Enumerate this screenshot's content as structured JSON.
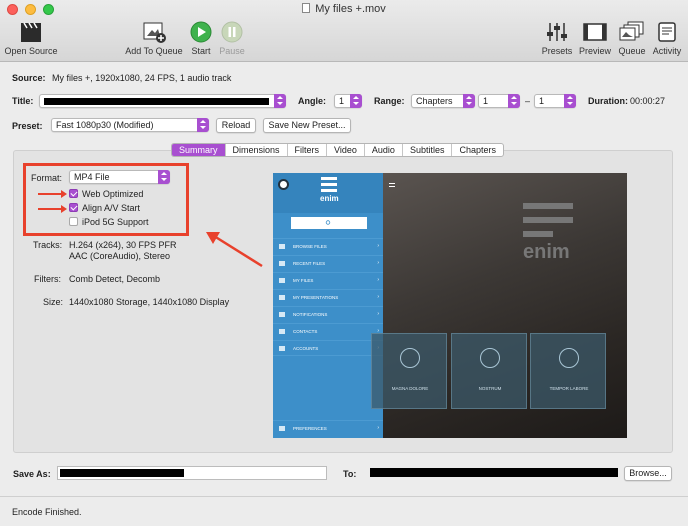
{
  "window": {
    "title": "My files +.mov"
  },
  "toolbar": {
    "open_source": "Open Source",
    "add_to_queue": "Add To Queue",
    "start": "Start",
    "pause": "Pause",
    "presets": "Presets",
    "preview": "Preview",
    "queue": "Queue",
    "activity": "Activity"
  },
  "source": {
    "label": "Source:",
    "value": "My files +, 1920x1080, 24 FPS, 1 audio track"
  },
  "title_row": {
    "label": "Title:",
    "angle_label": "Angle:",
    "angle_value": "1",
    "range_label": "Range:",
    "range_type": "Chapters",
    "range_from": "1",
    "range_sep": "–",
    "range_to": "1",
    "duration_label": "Duration:",
    "duration_value": "00:00:27"
  },
  "preset": {
    "label": "Preset:",
    "value": "Fast 1080p30 (Modified)",
    "reload": "Reload",
    "save_new": "Save New Preset..."
  },
  "tabs": [
    "Summary",
    "Dimensions",
    "Filters",
    "Video",
    "Audio",
    "Subtitles",
    "Chapters"
  ],
  "active_tab": "Summary",
  "summary": {
    "format_label": "Format:",
    "format_value": "MP4 File",
    "web_optimized": "Web Optimized",
    "align_av": "Align A/V Start",
    "ipod": "iPod 5G Support",
    "tracks_label": "Tracks:",
    "tracks_line1": "H.264 (x264), 30 FPS PFR",
    "tracks_line2": "AAC (CoreAudio), Stereo",
    "filters_label": "Filters:",
    "filters_value": "Comb Detect, Decomb",
    "size_label": "Size:",
    "size_value": "1440x1080 Storage, 1440x1080 Display"
  },
  "checkboxes": {
    "web_optimized": true,
    "align_av": true,
    "ipod": false
  },
  "preview_image": {
    "logo": "enim",
    "menu": [
      "BROWSE FILES",
      "RECENT FILES",
      "MY FILES",
      "MY PRESENTATIONS",
      "NOTIFICATIONS",
      "CONTACTS",
      "ACCOUNTS"
    ],
    "preferences": "PREFERENCES",
    "tiles": [
      "MAGNA DOLORE",
      "NOSTRUM",
      "TEMPOR LABORE"
    ],
    "big_logo": "enim"
  },
  "save_as": {
    "label": "Save As:",
    "to_label": "To:",
    "browse": "Browse..."
  },
  "status": {
    "text": "Encode Finished."
  },
  "colors": {
    "accent": "#a84fd0",
    "annotation": "#e8412c"
  }
}
